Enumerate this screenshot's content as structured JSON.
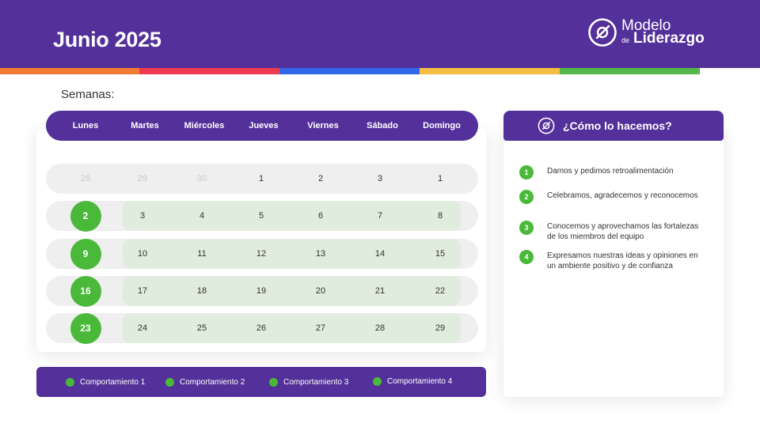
{
  "header": {
    "title": "Junio 2025"
  },
  "logo": {
    "line1": "Modelo",
    "line2a": "de",
    "line2b": "Liderazgo"
  },
  "colors": {
    "primary": "#54309a",
    "accent": "#4ab93a",
    "stripes": [
      "#f07d33",
      "#ef3b50",
      "#3167e8",
      "#f5bd41",
      "#55b64a"
    ]
  },
  "weeks_label": "Semanas:",
  "calendar": {
    "days": [
      "Lunes",
      "Martes",
      "Miércoles",
      "Jueves",
      "Viernes",
      "Sábado",
      "Domingo"
    ],
    "first_row": [
      {
        "n": "28",
        "muted": true
      },
      {
        "n": "29",
        "muted": true
      },
      {
        "n": "30",
        "muted": true
      },
      {
        "n": "1",
        "muted": false
      },
      {
        "n": "2",
        "muted": false
      },
      {
        "n": "3",
        "muted": false
      },
      {
        "n": "1",
        "muted": false
      }
    ],
    "weeks": [
      {
        "badge": "2",
        "days": [
          "3",
          "4",
          "5",
          "6",
          "7",
          "8"
        ]
      },
      {
        "badge": "9",
        "days": [
          "10",
          "11",
          "12",
          "13",
          "14",
          "15"
        ]
      },
      {
        "badge": "16",
        "days": [
          "17",
          "18",
          "19",
          "20",
          "21",
          "22"
        ]
      },
      {
        "badge": "23",
        "days": [
          "24",
          "25",
          "26",
          "27",
          "28",
          "29"
        ]
      }
    ]
  },
  "legend": [
    "Comportamiento 1",
    "Comportamiento 2",
    "Comportamiento 3",
    "Comportamiento 4"
  ],
  "how": {
    "title": "¿Cómo lo hacemos?",
    "icon": "compass-icon",
    "steps": [
      {
        "num": "1",
        "text": "Damos y pedimos retroalimentación"
      },
      {
        "num": "2",
        "text": "Celebramos, agradecemos y reconocemos"
      },
      {
        "num": "3",
        "text": "Conocemos y aprovechamos las fortalezas de los miembros del equipo"
      },
      {
        "num": "4",
        "text": "Expresamos nuestras ideas y opiniones en un ambiente positivo y de confianza"
      }
    ]
  }
}
